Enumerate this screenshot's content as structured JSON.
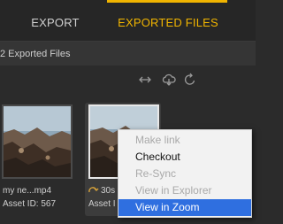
{
  "tabs": {
    "export_label": "EXPORT",
    "exported_files_label": "EXPORTED FILES",
    "active": "exported_files",
    "accent_color": "#f0b400"
  },
  "summary": {
    "count_label": "2 Exported Files"
  },
  "toolbar": {
    "icons": [
      "swap-arrows-icon",
      "cloud-sync-icon",
      "refresh-icon"
    ]
  },
  "files": [
    {
      "name": "my ne...mp4",
      "asset": "Asset ID: 567",
      "selected": false
    },
    {
      "name": "30s",
      "asset": "Asset I",
      "selected": true,
      "status_icon": "sync-icon"
    }
  ],
  "context_menu": {
    "items": [
      {
        "label": "Make link",
        "enabled": false
      },
      {
        "label": "Checkout",
        "enabled": true
      },
      {
        "label": "Re-Sync",
        "enabled": false
      },
      {
        "label": "View in Explorer",
        "enabled": false
      },
      {
        "label": "View in Zoom",
        "enabled": true,
        "highlighted": true
      }
    ],
    "highlight_color": "#2f6fe0"
  }
}
